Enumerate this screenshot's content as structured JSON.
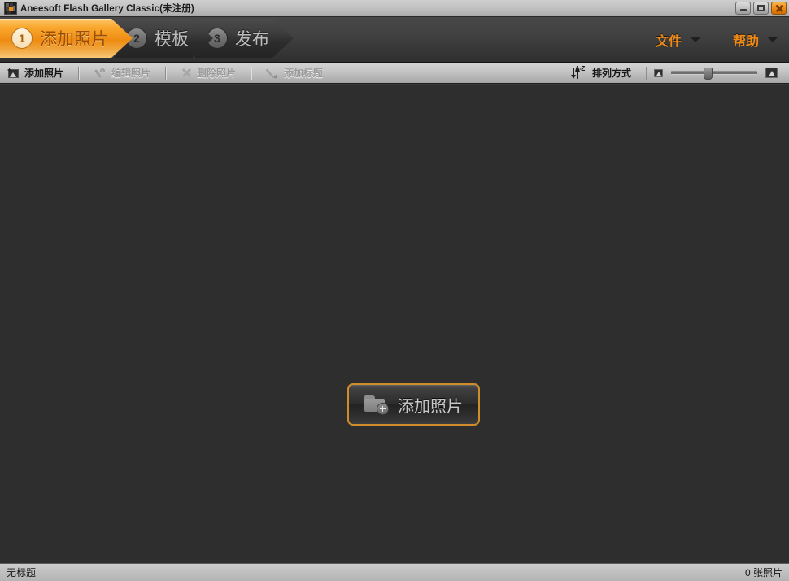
{
  "window": {
    "title": "Aneesoft Flash Gallery Classic(未注册)",
    "app_icon": "app-mosaic-icon",
    "controls": {
      "minimize": "minimize-icon",
      "maximize": "maximize-icon",
      "close": "close-icon"
    }
  },
  "nav": {
    "steps": [
      {
        "number": "1",
        "label": "添加照片",
        "state": "active"
      },
      {
        "number": "2",
        "label": "模板",
        "state": "inactive"
      },
      {
        "number": "3",
        "label": "发布",
        "state": "inactive"
      }
    ],
    "menus": [
      {
        "label": "文件",
        "icon": "chevron-down-icon"
      },
      {
        "label": "帮助",
        "icon": "chevron-down-icon"
      }
    ]
  },
  "toolbar": {
    "items": [
      {
        "label": "添加照片",
        "icon": "add-photo-icon",
        "enabled": true
      },
      {
        "label": "编辑照片",
        "icon": "wrench-icon",
        "enabled": false
      },
      {
        "label": "删除照片",
        "icon": "close-x-icon",
        "enabled": false
      },
      {
        "label": "添加标题",
        "icon": "pencil-icon",
        "enabled": false
      }
    ],
    "sort": {
      "label": "排列方式",
      "icon": "sort-az-icon"
    },
    "zoom_slider": {
      "small_icon": "small-thumbnail-icon",
      "large_icon": "large-thumbnail-icon",
      "value_percent": 42
    }
  },
  "canvas": {
    "add_button": {
      "label": "添加照片",
      "icon": "folder-add-icon"
    }
  },
  "statusbar": {
    "left": "无标题",
    "right": "0 张照片"
  },
  "colors": {
    "accent_orange": "#f08a14",
    "active_step_orange": "#ef8c12",
    "canvas_bg": "#2e2e2e",
    "chrome_gray": "#c0c0c0",
    "nav_dark": "#3a3a3a"
  }
}
